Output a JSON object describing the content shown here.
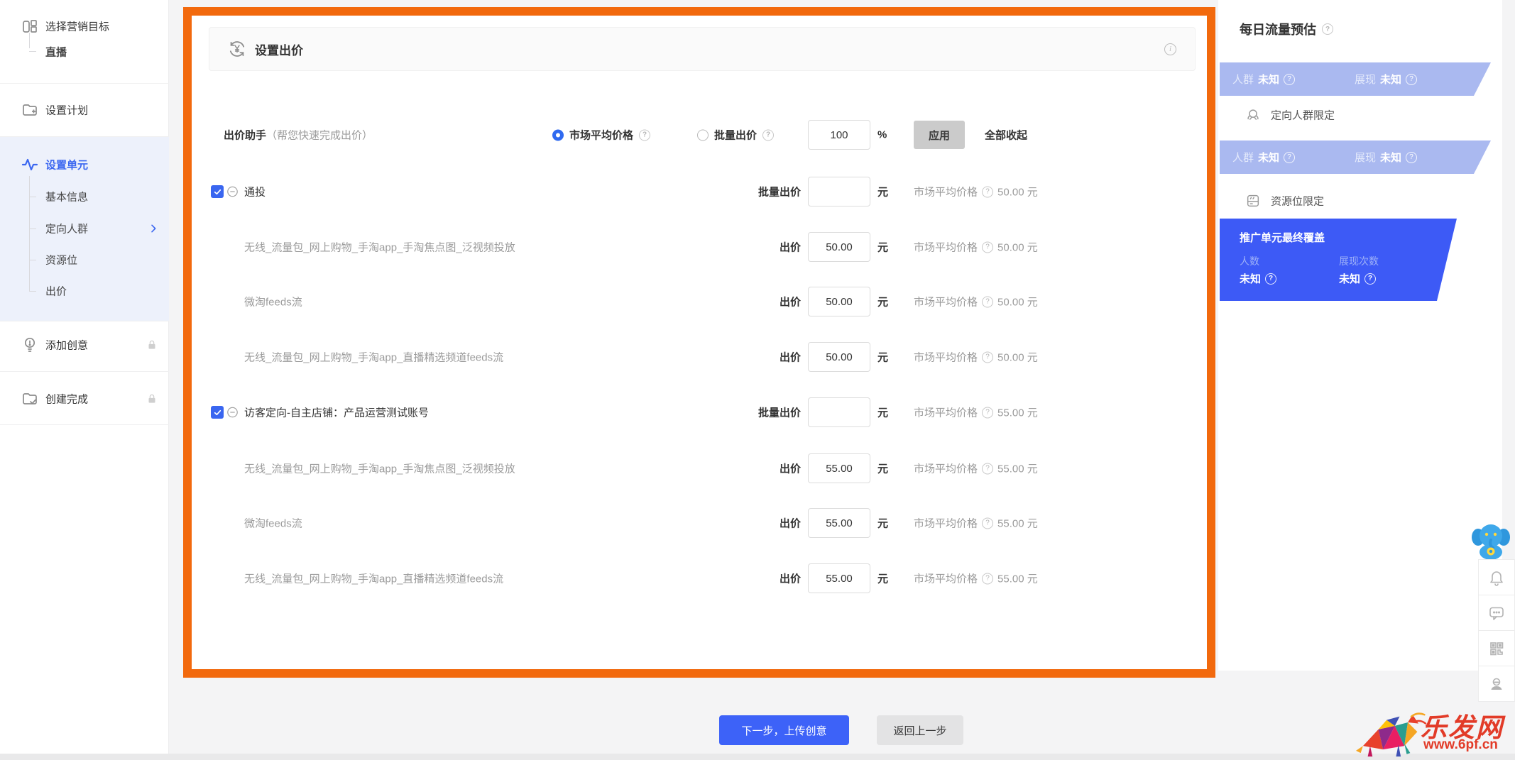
{
  "colors": {
    "accent_blue": "#3a66f0",
    "highlight_orange": "#f2690d",
    "banner_light_blue": "#aab9f0",
    "banner_dark_blue": "#3d5af6"
  },
  "sidebar": {
    "step1": {
      "label": "选择营销目标",
      "sub": "直播"
    },
    "step2": {
      "label": "设置计划"
    },
    "step3": {
      "label": "设置单元",
      "sub1": "基本信息",
      "sub2": "定向人群",
      "sub3": "资源位",
      "sub4": "出价"
    },
    "step4": {
      "label": "添加创意"
    },
    "step5": {
      "label": "创建完成"
    }
  },
  "panel": {
    "title": "设置出价",
    "labels": {
      "bid": "出价",
      "batch": "批量出价",
      "unit": "元",
      "market": "市场平均价格",
      "percent": "%"
    },
    "assistant": {
      "label": "出价助手",
      "hint": "（帮您快速完成出价）",
      "option_market": "市场平均价格",
      "option_batch": "批量出价",
      "percent_value": "100",
      "apply": "应用",
      "collapse_all": "全部收起"
    },
    "groups": [
      {
        "name": "通投",
        "batch_value": "",
        "market_value": "50.00 元",
        "rows": [
          {
            "name": "无线_流量包_网上购物_手淘app_手淘焦点图_泛视频投放",
            "bid": "50.00",
            "market_value": "50.00 元"
          },
          {
            "name": "微淘feeds流",
            "bid": "50.00",
            "market_value": "50.00 元"
          },
          {
            "name": "无线_流量包_网上购物_手淘app_直播精选频道feeds流",
            "bid": "50.00",
            "market_value": "50.00 元"
          }
        ]
      },
      {
        "name": "访客定向-自主店铺：产品运营测试账号",
        "batch_value": "",
        "market_value": "55.00 元",
        "rows": [
          {
            "name": "无线_流量包_网上购物_手淘app_手淘焦点图_泛视频投放",
            "bid": "55.00",
            "market_value": "55.00 元"
          },
          {
            "name": "微淘feeds流",
            "bid": "55.00",
            "market_value": "55.00 元"
          },
          {
            "name": "无线_流量包_网上购物_手淘app_直播精选频道feeds流",
            "bid": "55.00",
            "market_value": "55.00 元"
          }
        ]
      }
    ]
  },
  "estimate": {
    "title": "每日流量预估",
    "audience_label": "人群",
    "impression_label": "展现",
    "unknown": "未知",
    "targeting_label": "定向人群限定",
    "resource_label": "资源位限定",
    "final": {
      "title": "推广单元最终覆盖",
      "people_label": "人数",
      "impressions_label": "展现次数",
      "people_value": "未知",
      "impressions_value": "未知"
    }
  },
  "footer": {
    "next": "下一步，上传创意",
    "back": "返回上一步"
  },
  "watermark": {
    "site": "乐发网",
    "url": "www.6pf.cn"
  }
}
